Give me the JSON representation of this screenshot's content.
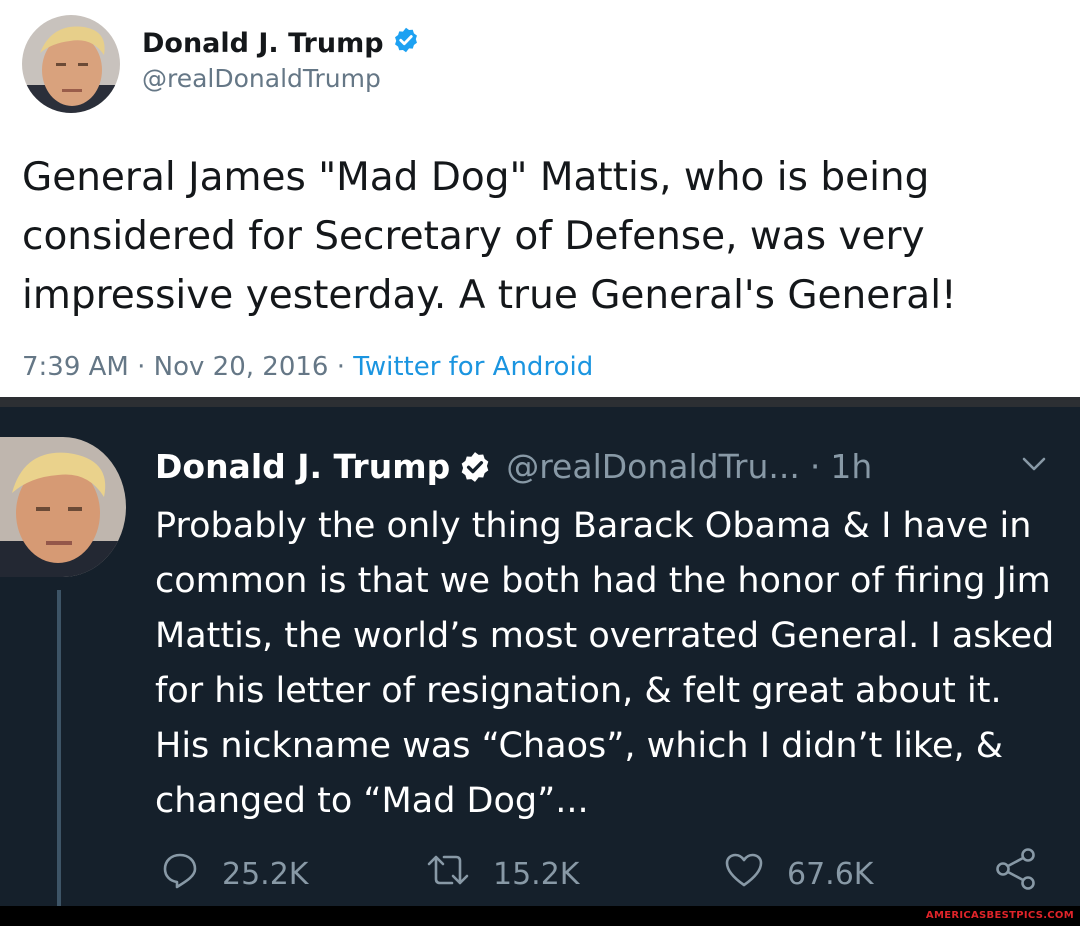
{
  "tweet_top": {
    "avatar_icon": "profile-photo",
    "name": "Donald J. Trump",
    "verified_icon": "verified-badge-icon",
    "handle": "@realDonaldTrump",
    "text": "General James \"Mad Dog\" Mattis, who is being considered for Secretary of Defense, was very impressive yesterday. A true General's General!",
    "timestamp": "7:39 AM · Nov 20, 2016 · ",
    "source": "Twitter for Android",
    "colors": {
      "background": "#ffffff",
      "text": "#14171a",
      "secondary": "#657786",
      "link": "#1b95e0",
      "verified": "#1da1f2"
    }
  },
  "tweet_bottom": {
    "avatar_icon": "profile-photo",
    "name": "Donald J. Trump",
    "verified_icon": "verified-badge-icon",
    "handle": "@realDonaldTru...",
    "separator": "·",
    "age": "1h",
    "menu_icon": "chevron-down-icon",
    "text": "Probably the only thing Barack Obama & I have in common is that we both had the honor of firing Jim Mattis, the world’s most overrated General. I asked for his letter of resignation, & felt great about it. His nickname was “Chaos”, which I didn’t like, & changed to “Mad Dog”...",
    "actions": {
      "reply_icon": "reply-icon",
      "replies": "25.2K",
      "retweet_icon": "retweet-icon",
      "retweets": "15.2K",
      "like_icon": "heart-icon",
      "likes": "67.6K",
      "share_icon": "share-icon"
    },
    "colors": {
      "background": "#15202b",
      "text": "#ffffff",
      "secondary": "#8899a6",
      "thread_line": "#3d5466"
    }
  },
  "watermark": "AMERICASBESTPICS.COM"
}
